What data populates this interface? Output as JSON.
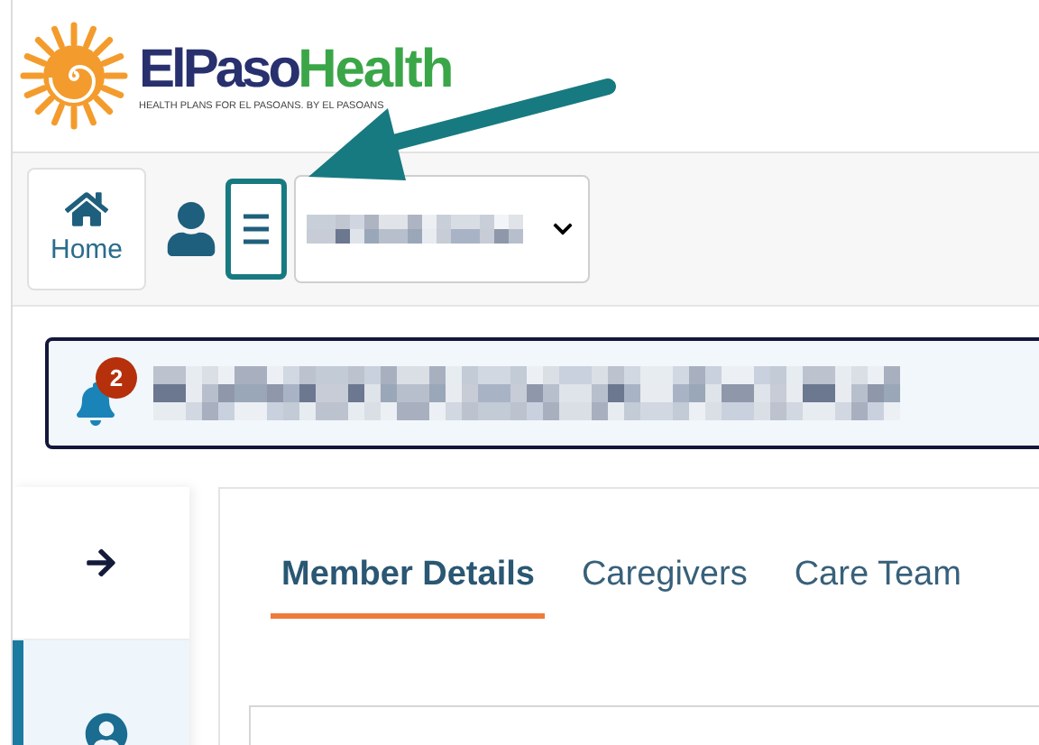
{
  "logo": {
    "name_part_1": "ElPaso",
    "name_part_2": "Health",
    "tagline": "HEALTH PLANS FOR EL PASOANS. BY EL PASOANS"
  },
  "toolbar": {
    "home_label": "Home",
    "menu_highlighted": true
  },
  "alert": {
    "badge": "2"
  },
  "sidebar": {
    "items": [
      {
        "kind": "arrow",
        "selected": false
      },
      {
        "kind": "user",
        "selected": true
      }
    ]
  },
  "tabs": [
    {
      "label": "Member Details",
      "selected": true
    },
    {
      "label": "Caregivers",
      "selected": false
    },
    {
      "label": "Care Team",
      "selected": false
    }
  ]
}
